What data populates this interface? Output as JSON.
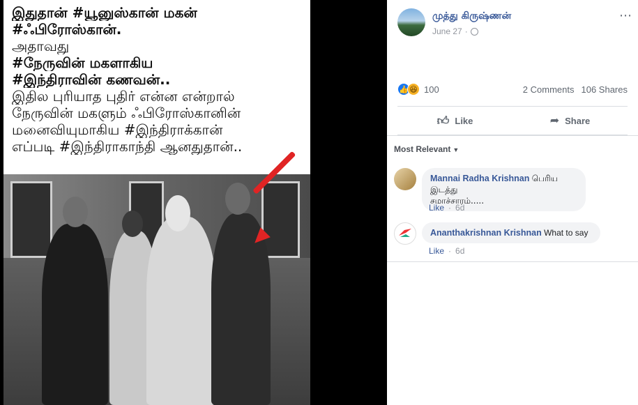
{
  "photo": {
    "caption_lines": [
      "இதுதான் #யூனுஸ்கான் மகன்",
      "#ஃபிரோஸ்கான்.",
      "அதாவது",
      "#நேருவின் மகளாகிய",
      "#இந்திராவின் கணவன்..",
      "இதில புரியாத புதிர் என்ன என்றால்",
      "நேருவின் மகளும் ஃபிரோஸ்கானின்",
      "மனைவியுமாகிய #இந்திராக்கான்",
      "எப்படி #இந்திராகாந்தி ஆனதுதான்.."
    ],
    "arrow_color": "#e02424"
  },
  "post": {
    "author": "முத்து கிருஷ்ணன்",
    "date": "June 27",
    "privacy_icon": "globe-icon",
    "more_icon": "more-options-icon"
  },
  "stats": {
    "reaction_count": "100",
    "comments": "2 Comments",
    "shares": "106 Shares"
  },
  "actions": {
    "like_label": "Like",
    "share_label": "Share"
  },
  "comments": {
    "sort_label": "Most Relevant",
    "items": [
      {
        "name": "Mannai Radha Krishnan",
        "text_line1": "பெரிய இடத்து",
        "text_line2": "சமாச்சாரம்.....",
        "like": "Like",
        "time": "6d"
      },
      {
        "name": "Ananthakrishnan Krishnan",
        "text_line1": "What to say",
        "like": "Like",
        "time": "6d"
      }
    ]
  },
  "colors": {
    "link": "#385898",
    "muted": "#90949c",
    "like_blue": "#1877f2",
    "haha_yellow": "#f7b125"
  }
}
